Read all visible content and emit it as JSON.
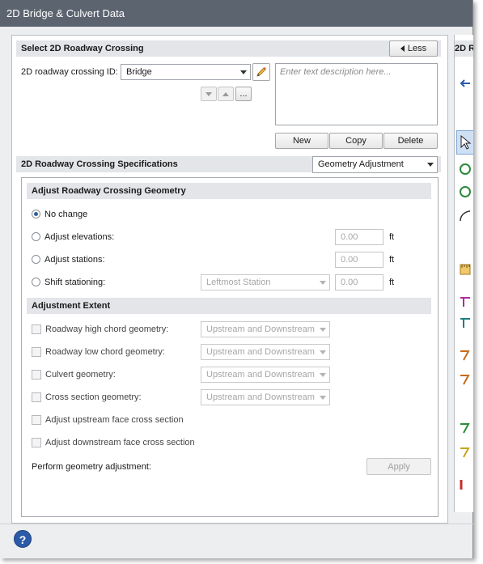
{
  "window": {
    "title": "2D Bridge & Culvert Data"
  },
  "select_section": {
    "header": "Select 2D Roadway Crossing",
    "less_label": "Less",
    "crossing_id_label": "2D roadway crossing ID:",
    "crossing_id_value": "Bridge",
    "description_placeholder": "Enter text description here...",
    "browse_label": "...",
    "new_label": "New",
    "copy_label": "Copy",
    "delete_label": "Delete"
  },
  "specs_section": {
    "header": "2D Roadway Crossing Specifications",
    "mode_value": "Geometry Adjustment"
  },
  "geometry": {
    "header": "Adjust Roadway Crossing Geometry",
    "options": {
      "no_change": "No change",
      "adjust_elevations": "Adjust elevations:",
      "adjust_stations": "Adjust stations:",
      "shift_stationing": "Shift stationing:"
    },
    "elevation_value": "0.00",
    "station_value": "0.00",
    "shift_value": "0.00",
    "shift_ref_value": "Leftmost Station",
    "unit": "ft"
  },
  "extent": {
    "header": "Adjustment Extent",
    "high_chord_label": "Roadway high chord geometry:",
    "low_chord_label": "Roadway low chord geometry:",
    "culvert_label": "Culvert geometry:",
    "cross_section_label": "Cross section geometry:",
    "extent_value": "Upstream and Downstream",
    "upstream_face_label": "Adjust upstream face cross section",
    "downstream_face_label": "Adjust downstream face cross section",
    "perform_label": "Perform geometry adjustment:",
    "apply_label": "Apply"
  },
  "side_panel": {
    "header": "2D R"
  },
  "help": {
    "label": "?"
  },
  "colors": {
    "titlebar": "#5c6470",
    "header_bg": "#e3e5e8",
    "radio_dot": "#2e5f9a",
    "help_blue": "#2b5aa8"
  }
}
